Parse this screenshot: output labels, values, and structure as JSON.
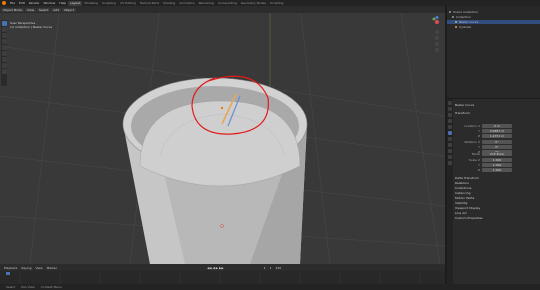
{
  "topbar": {
    "menus": [
      "File",
      "Edit",
      "Render",
      "Window",
      "Help"
    ],
    "workspaces": [
      "Layout",
      "Modeling",
      "Sculpting",
      "UV Editing",
      "Texture Paint",
      "Shading",
      "Animation",
      "Rendering",
      "Compositing",
      "Geometry Nodes",
      "Scripting"
    ],
    "active_workspace": "Layout"
  },
  "viewport": {
    "header_buttons": [
      "Object Mode",
      "View",
      "Select",
      "Add",
      "Object"
    ],
    "overlay_line1": "User Perspective",
    "overlay_line2": "(1) Collection | Bezier Curve"
  },
  "outliner": {
    "rows": [
      {
        "label": "Scene Collection",
        "color": "#9a9a9a",
        "selected": false
      },
      {
        "label": "Collection",
        "color": "#9a9a9a",
        "selected": false
      },
      {
        "label": "Bezier Curve",
        "color": "#b3c26b",
        "selected": true
      },
      {
        "label": "Cylinder",
        "color": "#e89a4b",
        "selected": false
      }
    ]
  },
  "properties": {
    "object_name": "Bezier Curve",
    "panel": "Transform",
    "location_label": "Location X",
    "location": [
      "0 m",
      "0.9857 m",
      "1.4371 m"
    ],
    "rotation_label": "Rotation X",
    "rotation": [
      "0°",
      "0°",
      "0°"
    ],
    "mode_label": "Mode",
    "mode_value": "XYZ Euler",
    "scale_label": "Scale X",
    "scale": [
      "1.000",
      "1.000",
      "1.000"
    ],
    "sections": [
      "Delta Transform",
      "Relations",
      "Collections",
      "Instancing",
      "Motion Paths",
      "Visibility",
      "Viewport Display",
      "Line Art",
      "Custom Properties"
    ]
  },
  "timeline": {
    "items": [
      "Playback",
      "Keying",
      "View",
      "Marker"
    ],
    "current_frame": "1",
    "start": "1",
    "end": "250"
  },
  "statusbar": {
    "items": [
      "Select",
      "Pan View",
      "Context Menu"
    ]
  }
}
